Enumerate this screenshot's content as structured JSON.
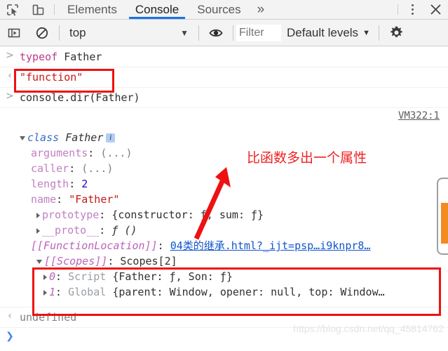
{
  "devtools": {
    "tabs": [
      {
        "label": "Elements",
        "active": false
      },
      {
        "label": "Console",
        "active": true
      },
      {
        "label": "Sources",
        "active": false
      }
    ],
    "more_tabs_label": "»",
    "inspect_icon": "inspect-element-icon",
    "device_icon": "device-toolbar-icon",
    "kebab_icon": "more-options-icon",
    "close_icon": "close-icon"
  },
  "toolbar": {
    "sidebar_toggle_icon": "console-sidebar-icon",
    "clear_icon": "clear-console-icon",
    "context": "top",
    "context_caret": "▼",
    "eye_icon": "live-expression-icon",
    "filter_placeholder": "Filter",
    "filter_value": "",
    "levels_label": "Default levels",
    "levels_caret": "▼",
    "settings_icon": "gear-icon"
  },
  "console": {
    "source_link": "VM322:1",
    "entries": [
      {
        "gutter": ">",
        "type": "input",
        "text": "typeof Father"
      },
      {
        "gutter": "‹",
        "type": "output",
        "text": "\"function\""
      },
      {
        "gutter": ">",
        "type": "input",
        "text": "console.dir(Father)"
      }
    ],
    "object": {
      "header_keyword": "class",
      "header_name": "Father",
      "info_badge": "i",
      "properties": [
        {
          "name": "arguments",
          "value": "(...)"
        },
        {
          "name": "caller",
          "value": "(...)"
        },
        {
          "name": "length",
          "value": "2"
        },
        {
          "name": "name",
          "value": "\"Father\""
        },
        {
          "name": "prototype",
          "value": "{constructor: ƒ, sum: ƒ}"
        },
        {
          "name": "__proto__",
          "value": "ƒ ()"
        },
        {
          "name": "[[FunctionLocation]]",
          "value": "04类的继承.html?_ijt=psp…i9knpr8…"
        },
        {
          "name": "[[Scopes]]",
          "value": "Scopes[2]"
        }
      ],
      "scopes": [
        {
          "index": "0",
          "kind": "Script",
          "value": "{Father: ƒ, Son: ƒ}"
        },
        {
          "index": "1",
          "kind": "Global",
          "value": "{parent: Window, opener: null, top: Window…"
        }
      ]
    },
    "result": {
      "gutter": "‹",
      "text": "undefined"
    },
    "prompt_caret": "❯"
  },
  "annotations": {
    "note_text": "比函数多出一个属性",
    "highlight_color": "#ee1111",
    "arrow_name": "red-arrow"
  },
  "watermark": {
    "text": "https://blog.csdn.net/qq_45814762"
  }
}
